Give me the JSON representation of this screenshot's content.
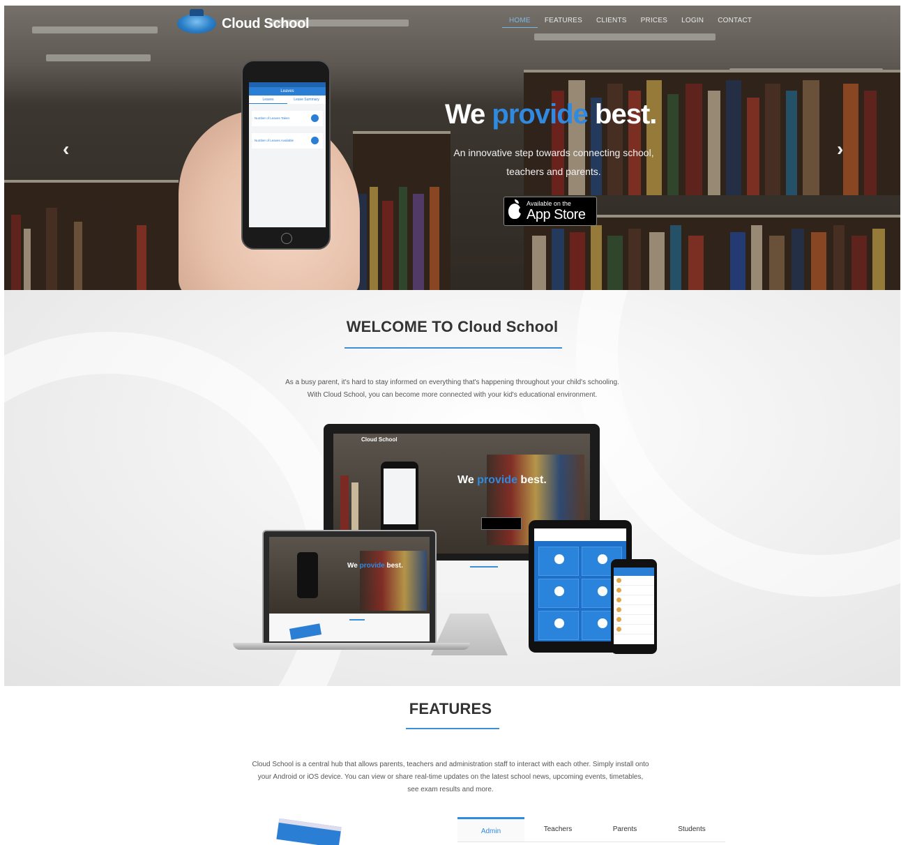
{
  "brand": {
    "name": "Cloud School"
  },
  "nav": {
    "items": [
      "HOME",
      "FEATURES",
      "CLIENTS",
      "PRICES",
      "LOGIN",
      "CONTACT"
    ],
    "active": "HOME"
  },
  "hero": {
    "title_pre": "We",
    "title_highlight": "provide",
    "title_post": "best.",
    "subtitle_line1": "An innovative step towards connecting school,",
    "subtitle_line2": "teachers and parents.",
    "appstore_small": "Available on the",
    "appstore_big": "App Store",
    "phone_screen": {
      "header": "Leaves",
      "tabs": [
        "Leaves",
        "Leave Summary"
      ],
      "rows": [
        "Number of Leaves Taken",
        "Number of Leaves Available"
      ],
      "counts": [
        "0",
        "0"
      ]
    },
    "prev_icon": "‹",
    "next_icon": "›"
  },
  "welcome": {
    "title": "WELCOME TO Cloud School",
    "text_line1": "As a busy parent, it's hard to stay informed on everything that's happening throughout your child's schooling.",
    "text_line2": "With Cloud School, you can become more connected with your kid's educational environment."
  },
  "features": {
    "title": "FEATURES",
    "text_line1": "Cloud School is a central hub that allows parents, teachers and administration staff to interact with each other. Simply install onto",
    "text_line2": "your Android or iOS device. You can view or share real-time updates on the latest school news, upcoming events, timetables,",
    "text_line3": "see exam results and more.",
    "tabs": [
      "Admin",
      "Teachers",
      "Parents",
      "Students"
    ],
    "active_tab": "Admin"
  },
  "colors": {
    "accent": "#2f8ae0",
    "rule": "#3a8fd8"
  }
}
